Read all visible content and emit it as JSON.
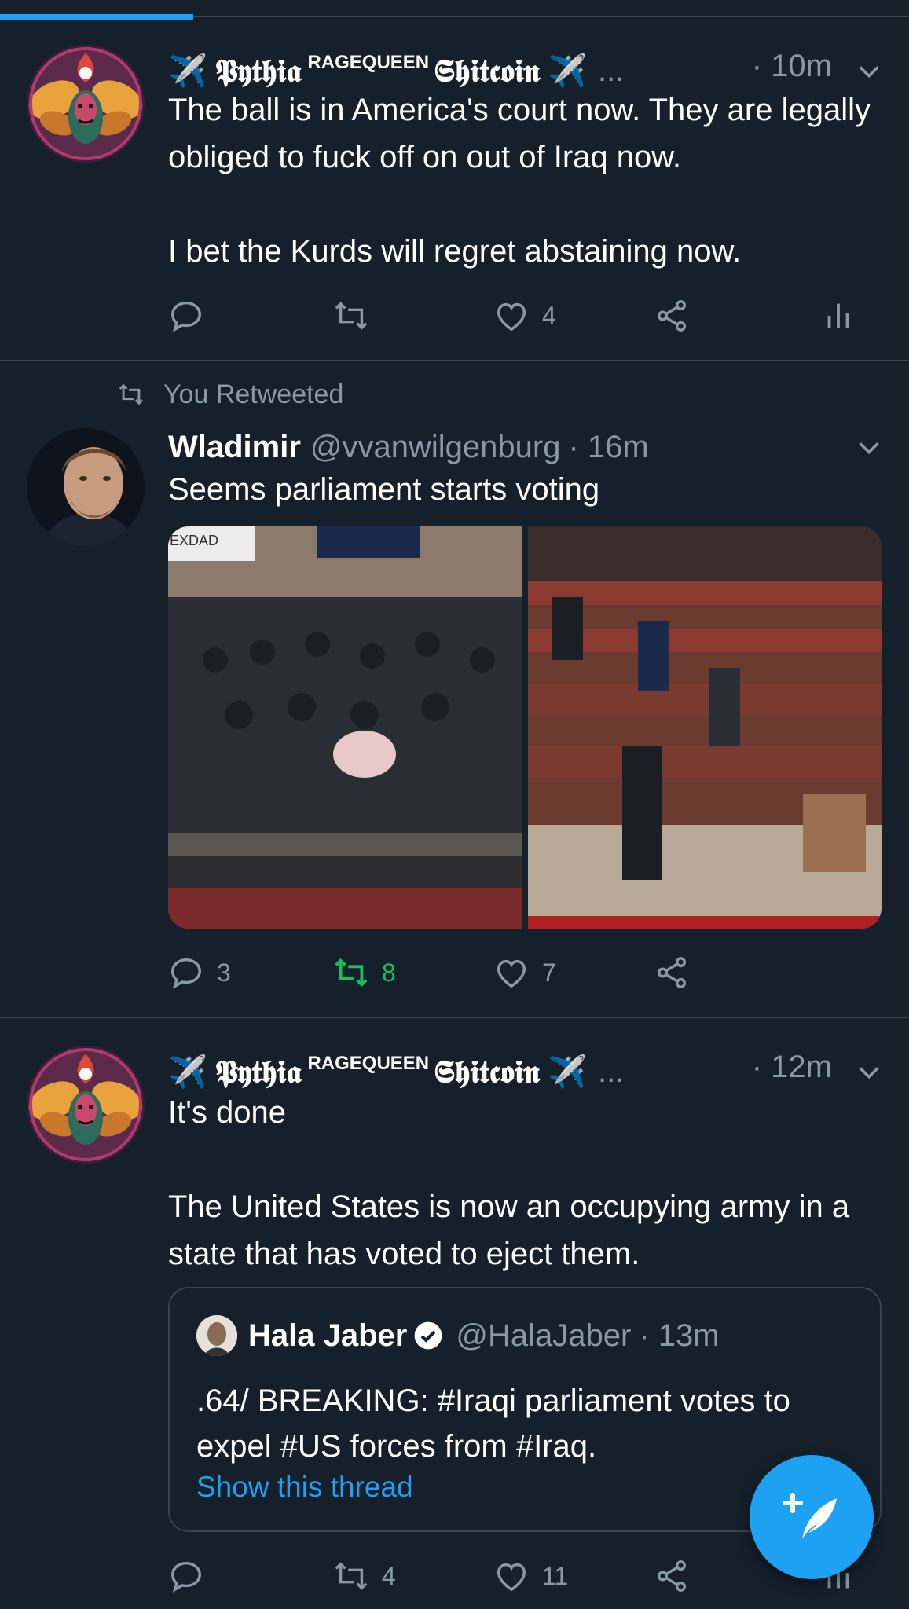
{
  "tweets": [
    {
      "name_prefix": "✈️",
      "name_main": "𝕻𝖞𝖙𝖍𝖎𝖆",
      "name_super": "RAGEQUEEN",
      "name_coin": "𝕾𝖍𝖎𝖙𝖈𝖔𝖎𝖓",
      "name_suffix": "✈️",
      "ellipsis": "...",
      "time": "· 10m",
      "text": "The ball is in America's court now. They are legally obliged to fuck off on out of Iraq now.\n\nI bet the Kurds will regret abstaining now.",
      "likes": "4"
    },
    {
      "social_context": "You Retweeted",
      "name": "Wladimir",
      "handle": "@vvanwilgenburg",
      "time": "· 16m",
      "text": "Seems parliament starts voting",
      "media_label": "EXDAD",
      "replies": "3",
      "retweets": "8",
      "likes": "7"
    },
    {
      "name_prefix": "✈️",
      "name_main": "𝕻𝖞𝖙𝖍𝖎𝖆",
      "name_super": "RAGEQUEEN",
      "name_coin": "𝕾𝖍𝖎𝖙𝖈𝖔𝖎𝖓",
      "name_suffix": "✈️",
      "ellipsis": "...",
      "time": "· 12m",
      "text": "It's done\n\nThe United States is now an occupying army in a state that has voted to eject them.",
      "retweets": "4",
      "likes": "11",
      "quote": {
        "name": "Hala Jaber",
        "handle": "@HalaJaber",
        "time": "· 13m",
        "text": ".64/ BREAKING: #Iraqi parliament votes to expel #US forces from #Iraq.",
        "link": "Show this thread"
      }
    }
  ],
  "colors": {
    "background": "#15202b",
    "accent": "#1da1f2",
    "retweet_green": "#17bf63",
    "muted": "#8899a6"
  }
}
